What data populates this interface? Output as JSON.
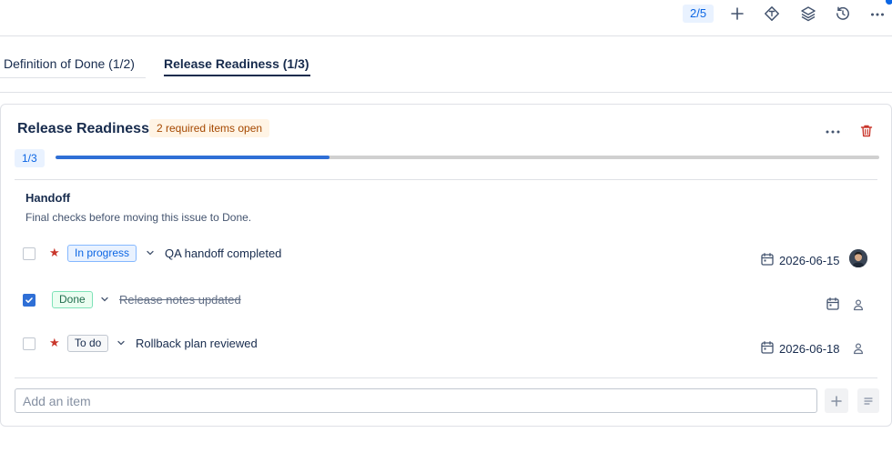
{
  "toolbar": {
    "counter": "2/5",
    "icons": [
      "plus-icon",
      "diamond-icon",
      "layers-icon",
      "history-icon",
      "more-icon"
    ]
  },
  "tabs": [
    {
      "label": "Definition of Done (1/2)",
      "active": false
    },
    {
      "label": "Release Readiness (1/3)",
      "active": true
    }
  ],
  "card": {
    "title": "Release Readiness",
    "required_badge": "2 required items open",
    "progress_label": "1/3",
    "progress": 0.333,
    "section": {
      "title": "Handoff",
      "description": "Final checks before moving this issue to Done."
    },
    "items": [
      {
        "checked": false,
        "required": true,
        "status": "In progress",
        "text": "QA handoff completed",
        "due": "2026-06-15",
        "assignee": "avatar"
      },
      {
        "checked": true,
        "required": false,
        "status": "Done",
        "text": "Release notes updated",
        "due": "",
        "assignee": "none"
      },
      {
        "checked": false,
        "required": true,
        "status": "To do",
        "text": "Rollback plan reviewed",
        "due": "2026-06-18",
        "assignee": "none"
      }
    ],
    "add_item_placeholder": "Add an item"
  },
  "colors": {
    "accent": "#0c66e4",
    "progress_fill": "#2f6fd6",
    "danger": "#c9372c",
    "warning_bg": "#fff4e5",
    "warning_text": "#a54800"
  }
}
